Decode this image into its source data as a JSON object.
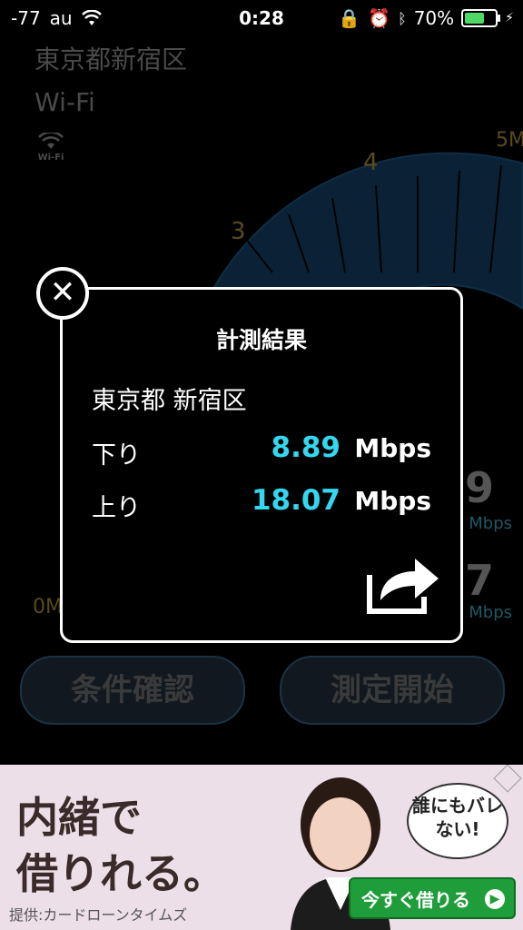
{
  "status_bar": {
    "signal": "-77",
    "carrier": "au",
    "time": "0:28",
    "battery": "70%",
    "battery_level": 0.7
  },
  "background": {
    "location": "東京都新宿区",
    "network": "Wi-Fi",
    "wifi_icon_label": "Wi-Fi",
    "gauge_ticks": [
      "0M",
      "3",
      "4",
      "5M"
    ],
    "download_partial": "9",
    "upload_partial": "7",
    "unit": "Mbps",
    "buttons": {
      "conditions": "条件確認",
      "start": "測定開始"
    }
  },
  "result_modal": {
    "title": "計測結果",
    "location": "東京都 新宿区",
    "download_label": "下り",
    "download_value": "8.89",
    "upload_label": "上り",
    "upload_value": "18.07",
    "unit": "Mbps"
  },
  "ad": {
    "line1": "内緒で",
    "line2": "借りれる。",
    "bubble": "誰にもバレない!",
    "cta": "今すぐ借りる",
    "provider": "提供:カードローンタイムズ",
    "accent_color": "#1f9d3a"
  }
}
